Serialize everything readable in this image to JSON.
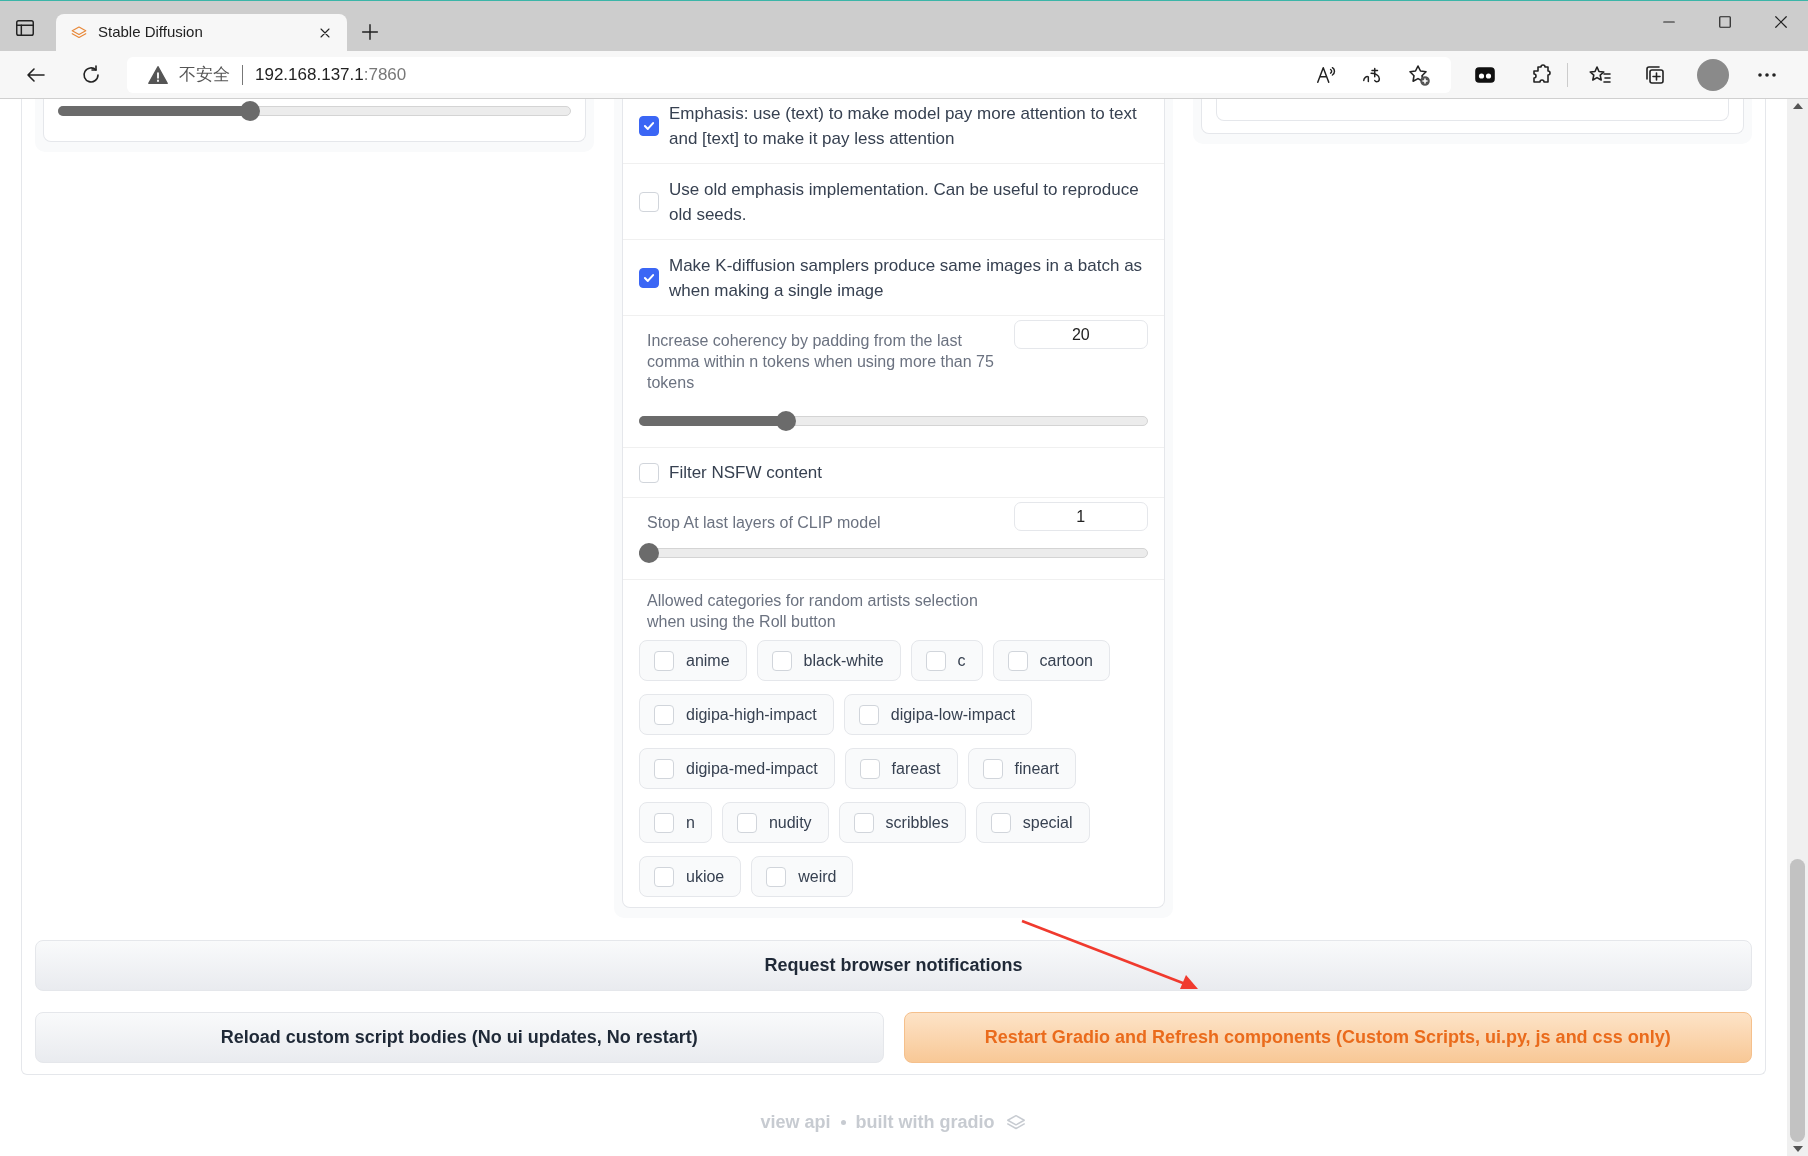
{
  "browser": {
    "tab": {
      "title": "Stable Diffusion"
    },
    "address": {
      "security": "不安全",
      "host": "192.168.137.1",
      "port": ":7860"
    }
  },
  "left_panel": {
    "slider": {
      "level": 0.37
    }
  },
  "settings": [
    {
      "kind": "checkbox",
      "label": "Emphasis: use (text) to make model pay more attention to text and [text] to make it pay less attention",
      "checked": true
    },
    {
      "kind": "checkbox",
      "label": "Use old emphasis implementation. Can be useful to reproduce old seeds.",
      "checked": false
    },
    {
      "kind": "checkbox",
      "label": "Make K-diffusion samplers produce same images in a batch as when making a single image",
      "checked": true
    },
    {
      "kind": "number_slider",
      "label": "Increase coherency by padding from the last comma within n tokens when using more than 75 tokens",
      "value": "20",
      "level": 0.28
    },
    {
      "kind": "checkbox",
      "label": "Filter NSFW content",
      "checked": false
    },
    {
      "kind": "number_slider",
      "label": "Stop At last layers of CLIP model",
      "value": "1",
      "level": 0
    },
    {
      "kind": "checkbox_group",
      "label": "Allowed categories for random artists selection when using the Roll button",
      "options": [
        {
          "label": "anime",
          "checked": false
        },
        {
          "label": "black-white",
          "checked": false
        },
        {
          "label": "c",
          "checked": false
        },
        {
          "label": "cartoon",
          "checked": false
        },
        {
          "label": "digipa-high-impact",
          "checked": false
        },
        {
          "label": "digipa-low-impact",
          "checked": false
        },
        {
          "label": "digipa-med-impact",
          "checked": false
        },
        {
          "label": "fareast",
          "checked": false
        },
        {
          "label": "fineart",
          "checked": false
        },
        {
          "label": "n",
          "checked": false
        },
        {
          "label": "nudity",
          "checked": false
        },
        {
          "label": "scribbles",
          "checked": false
        },
        {
          "label": "special",
          "checked": false
        },
        {
          "label": "ukioe",
          "checked": false
        },
        {
          "label": "weird",
          "checked": false
        }
      ]
    }
  ],
  "button_rows": [
    [
      {
        "label": "Request browser notifications",
        "kind": "secondary"
      }
    ],
    [
      {
        "label": "Reload custom script bodies (No ui updates, No restart)",
        "kind": "secondary"
      },
      {
        "label": "Restart Gradio and Refresh components (Custom Scripts, ui.py, js and css only)",
        "kind": "primary"
      }
    ]
  ],
  "footer": {
    "links": [
      "view api",
      "built with gradio"
    ]
  }
}
